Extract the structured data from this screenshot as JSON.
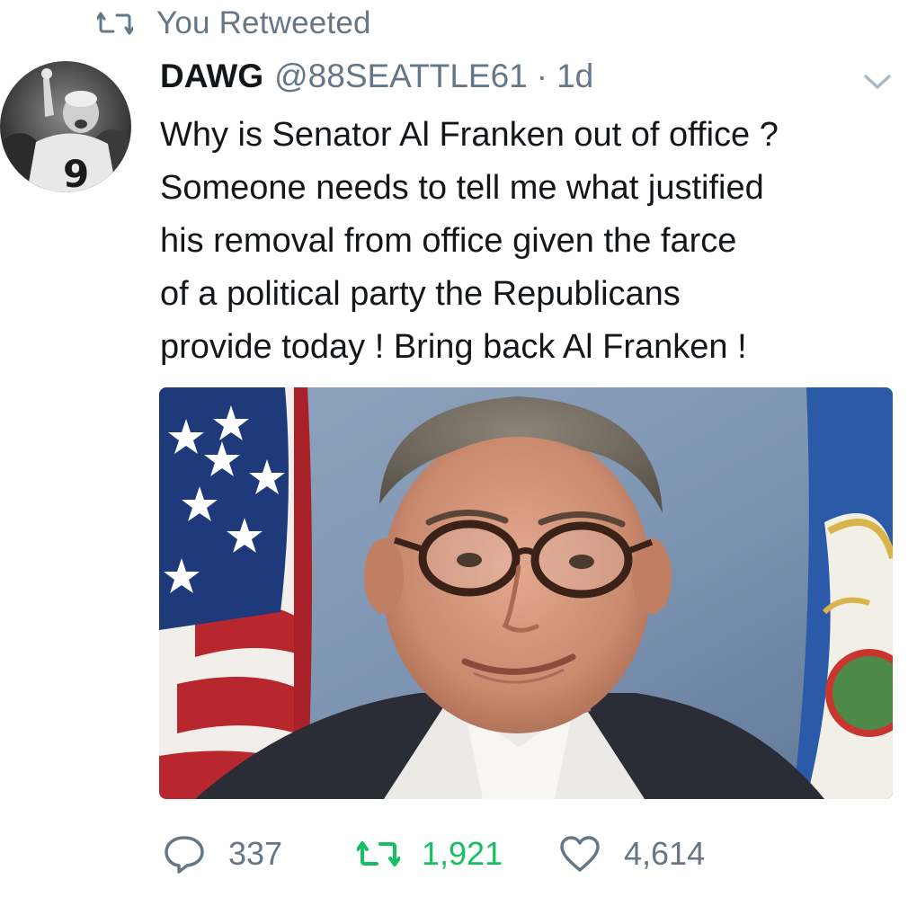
{
  "context": {
    "label": "You Retweeted",
    "icon": "retweet-icon"
  },
  "tweet": {
    "display_name": "DAWG",
    "handle": "@88SEATTLE61",
    "separator": "·",
    "timestamp": "1d",
    "text_lines": [
      "Why is Senator Al Franken out of office ?",
      "Someone needs to tell me what justified",
      "his removal from office given the farce",
      "of a political party the Republicans",
      "provide today !  Bring back Al Franken !"
    ]
  },
  "actions": {
    "reply_count": "337",
    "retweet_count": "1,921",
    "like_count": "4,614"
  },
  "colors": {
    "secondary_text": "#657786",
    "retweet_active": "#17bf63",
    "primary_text": "#14171a"
  }
}
